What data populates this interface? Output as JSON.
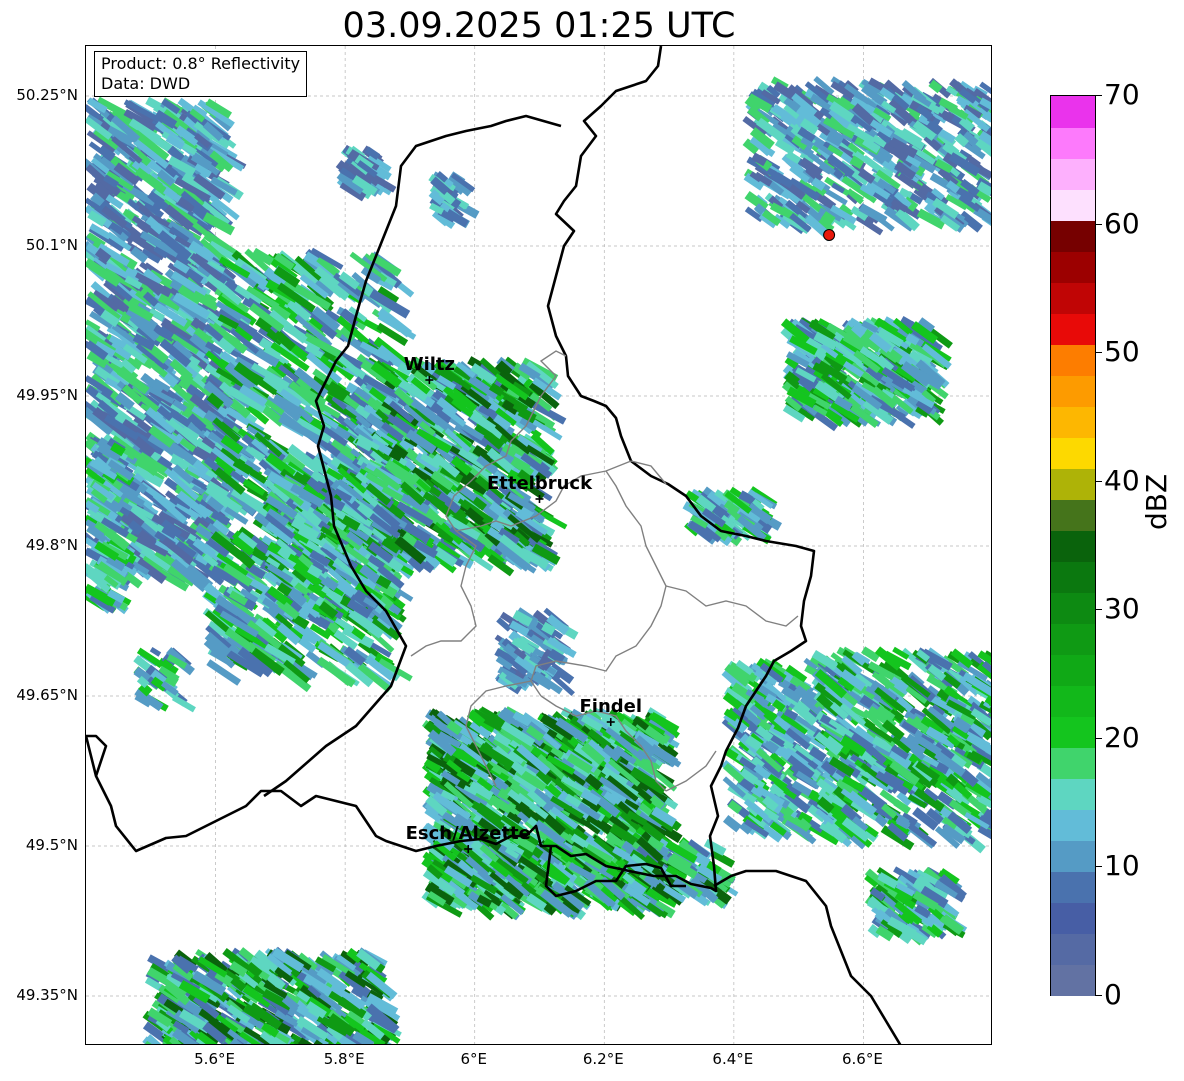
{
  "title": "03.09.2025 01:25 UTC",
  "info": {
    "product": "Product: 0.8° Reflectivity",
    "data": "Data: DWD"
  },
  "lat_labels": [
    "50.25°N",
    "50.1°N",
    "49.95°N",
    "49.8°N",
    "49.65°N",
    "49.5°N",
    "49.35°N"
  ],
  "lon_labels": [
    "5.6°E",
    "5.8°E",
    "6°E",
    "6.2°E",
    "6.4°E",
    "6.6°E"
  ],
  "cities": [
    {
      "name": "Wiltz",
      "lon": 5.93,
      "lat": 49.966
    },
    {
      "name": "Ettelbruck",
      "lon": 6.1,
      "lat": 49.847
    },
    {
      "name": "Findel",
      "lon": 6.21,
      "lat": 49.624
    },
    {
      "name": "Esch/Alzette",
      "lon": 5.99,
      "lat": 49.497
    }
  ],
  "radar_site": {
    "lon": 6.547,
    "lat": 50.111,
    "color": "#e8180c"
  },
  "map_extent": {
    "lon": [
      5.4,
      6.8
    ],
    "lat": [
      49.3,
      50.3
    ]
  },
  "colorbar": {
    "unit": "dBZ",
    "tick_labels": [
      "0",
      "10",
      "20",
      "30",
      "40",
      "50",
      "60",
      "70"
    ],
    "min": 0,
    "max": 70,
    "step": 2.5,
    "colors": [
      "#6272a3",
      "#556aa4",
      "#475ea5",
      "#4a72ae",
      "#559bc5",
      "#62bcd8",
      "#5ed6c1",
      "#40d46c",
      "#14c51e",
      "#12b81a",
      "#10a916",
      "#0f9a14",
      "#0d8a12",
      "#0b780f",
      "#0a630c",
      "#45741b",
      "#aeb307",
      "#fdd900",
      "#fdb701",
      "#fd9b00",
      "#fd7d00",
      "#e80a08",
      "#c00505",
      "#9c0000",
      "#760000",
      "#fde0fe",
      "#fdb0fd",
      "#fd7afc",
      "#ea33ec"
    ]
  },
  "precip_colors": [
    "#536aa4",
    "#4a72ae",
    "#559bc5",
    "#62bcd8",
    "#5ed6c1",
    "#40d46c",
    "#14c51e",
    "#0f9a14",
    "#0a630c"
  ]
}
